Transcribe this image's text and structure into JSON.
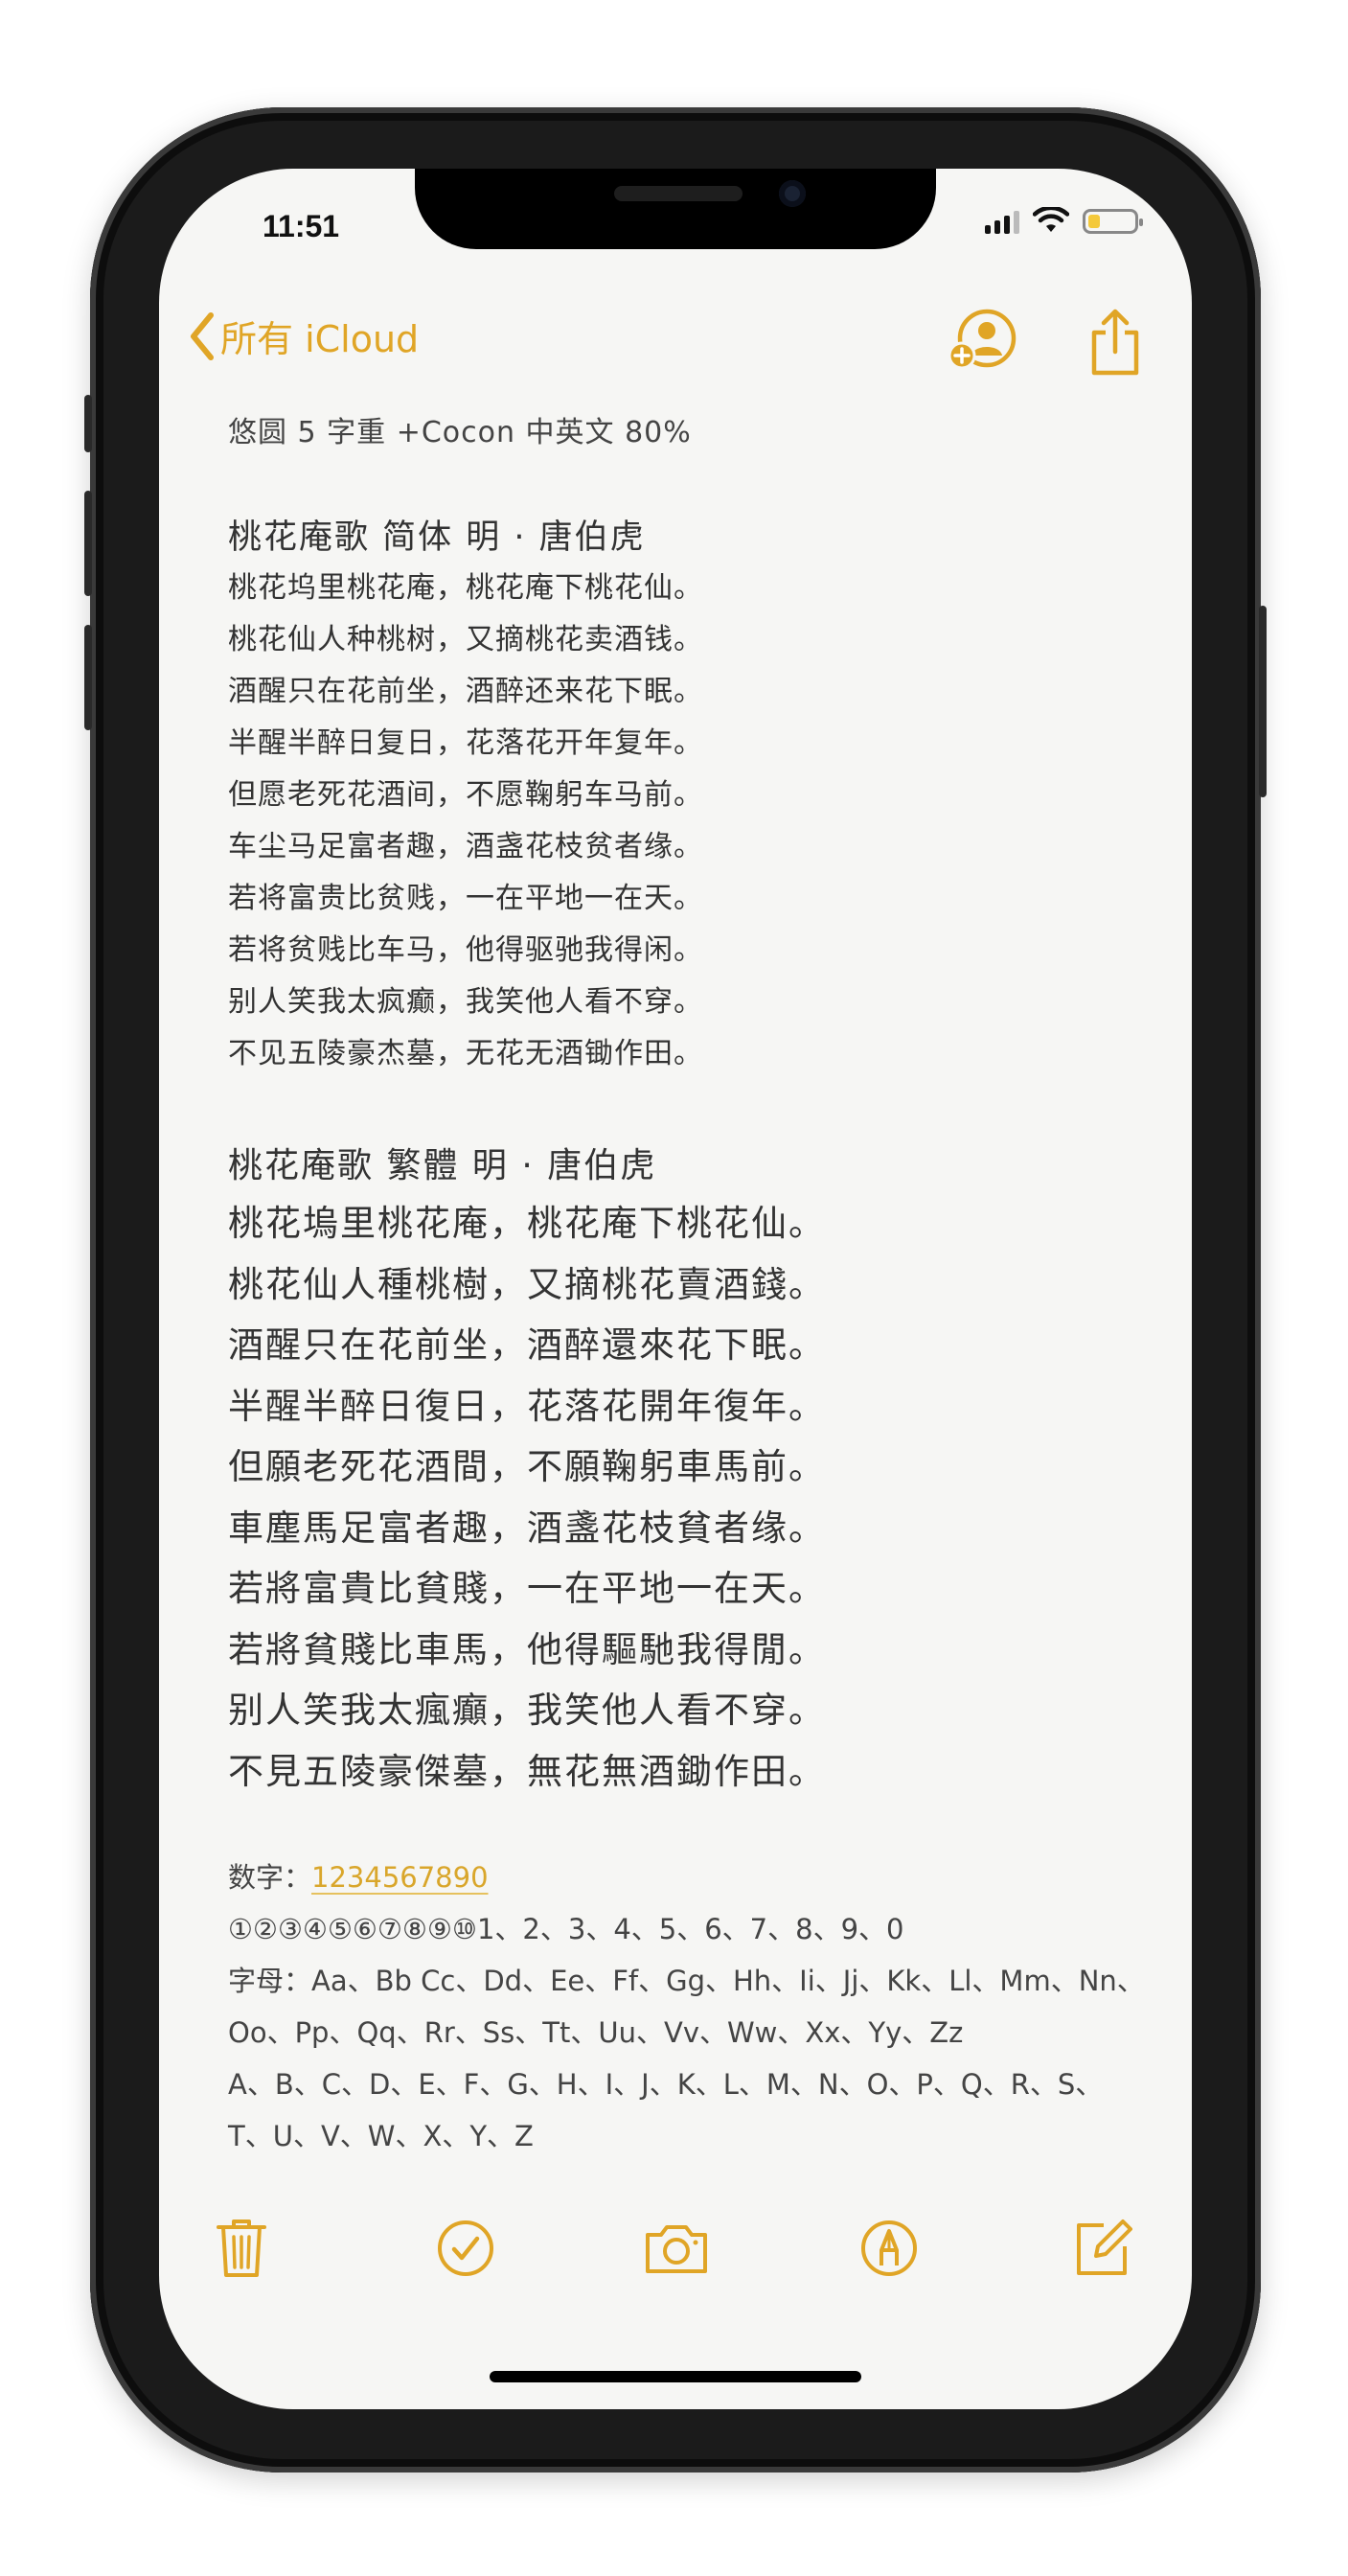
{
  "status_bar": {
    "time": "11:51"
  },
  "nav": {
    "back_label": "所有 iCloud",
    "icons": [
      "add-person-icon",
      "share-icon"
    ]
  },
  "note": {
    "font_note": "悠圆 5 字重 +Cocon 中英文 80%",
    "poem_simplified": {
      "title": "桃花庵歌 简体 明 · 唐伯虎",
      "lines": [
        "桃花坞里桃花庵，桃花庵下桃花仙。",
        "桃花仙人种桃树，又摘桃花卖酒钱。",
        "酒醒只在花前坐，酒醉还来花下眠。",
        "半醒半醉日复日，花落花开年复年。",
        "但愿老死花酒间，不愿鞠躬车马前。",
        "车尘马足富者趣，酒盏花枝贫者缘。",
        "若将富贵比贫贱，一在平地一在天。",
        "若将贫贱比车马，他得驱驰我得闲。",
        "别人笑我太疯癫，我笑他人看不穿。",
        "不见五陵豪杰墓，无花无酒锄作田。"
      ]
    },
    "poem_traditional": {
      "title": "桃花庵歌 繁體  明 · 唐伯虎",
      "lines": [
        "桃花塢里桃花庵，桃花庵下桃花仙。",
        "桃花仙人種桃樹，又摘桃花賣酒錢。",
        "酒醒只在花前坐，酒醉還來花下眠。",
        "半醒半醉日復日，花落花開年復年。",
        "但願老死花酒間，不願鞠躬車馬前。",
        "車塵馬足富者趣，酒盞花枝貧者缘。",
        "若將富貴比貧賤，一在平地一在天。",
        "若將貧賤比車馬，他得驅馳我得閒。",
        "别人笑我太瘋癲，我笑他人看不穿。",
        "不見五陵豪傑墓，無花無酒鋤作田。"
      ]
    },
    "digits_label": "数字：",
    "digits_value": "1234567890",
    "circled_line": "①②③④⑤⑥⑦⑧⑨⑩1、2、3、4、5、6、7、8、9、0",
    "letters_line1": "字母：Aa、Bb Cc、Dd、Ee、Ff、Gg、Hh、Ii、Jj、Kk、Ll、Mm、Nn、",
    "letters_line2": "Oo、Pp、Qq、Rr、Ss、Tt、Uu、Vv、Ww、Xx、Yy、Zz",
    "letters_line3": "A、B、C、D、E、F、G、H、I、J、K、L、M、N、O、P、Q、R、S、",
    "letters_line4": "T、U、V、W、X、Y、Z"
  },
  "toolbar": {
    "icons": [
      "trash-icon",
      "checklist-icon",
      "camera-icon",
      "markup-icon",
      "compose-icon"
    ]
  },
  "colors": {
    "accent": "#e0a526",
    "background": "#f6f6f4",
    "text": "#333333"
  }
}
